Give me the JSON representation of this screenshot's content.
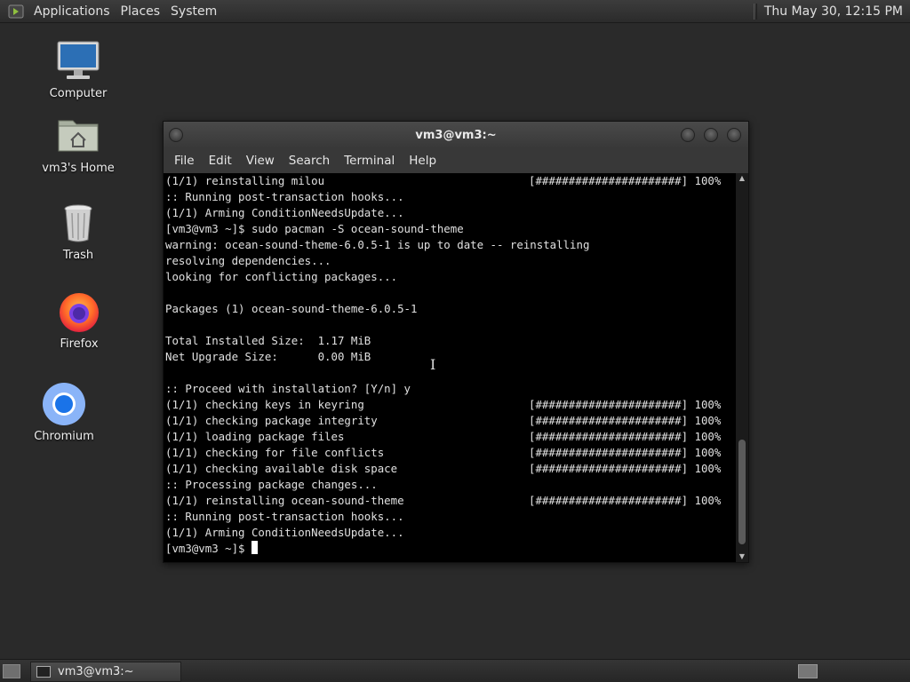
{
  "top_panel": {
    "menus": [
      "Applications",
      "Places",
      "System"
    ],
    "clock": "Thu May 30, 12:15 PM"
  },
  "desktop": {
    "icons": [
      {
        "label": "Computer",
        "icon": "computer-icon"
      },
      {
        "label": "vm3's Home",
        "icon": "home-folder-icon"
      },
      {
        "label": "Trash",
        "icon": "trash-icon"
      },
      {
        "label": "Firefox",
        "icon": "firefox-icon"
      },
      {
        "label": "Chromium",
        "icon": "chromium-icon"
      }
    ]
  },
  "window": {
    "title": "vm3@vm3:~",
    "menu": [
      "File",
      "Edit",
      "View",
      "Search",
      "Terminal",
      "Help"
    ]
  },
  "terminal": {
    "lines": [
      {
        "text": "(1/1) reinstalling milou",
        "progress": "[######################] 100%"
      },
      {
        "text": ":: Running post-transaction hooks...",
        "progress": ""
      },
      {
        "text": "(1/1) Arming ConditionNeedsUpdate...",
        "progress": ""
      },
      {
        "text": "[vm3@vm3 ~]$ sudo pacman -S ocean-sound-theme",
        "progress": ""
      },
      {
        "text": "warning: ocean-sound-theme-6.0.5-1 is up to date -- reinstalling",
        "progress": ""
      },
      {
        "text": "resolving dependencies...",
        "progress": ""
      },
      {
        "text": "looking for conflicting packages...",
        "progress": ""
      },
      {
        "text": "",
        "progress": ""
      },
      {
        "text": "Packages (1) ocean-sound-theme-6.0.5-1",
        "progress": ""
      },
      {
        "text": "",
        "progress": ""
      },
      {
        "text": "Total Installed Size:  1.17 MiB",
        "progress": ""
      },
      {
        "text": "Net Upgrade Size:      0.00 MiB",
        "progress": ""
      },
      {
        "text": "",
        "progress": ""
      },
      {
        "text": ":: Proceed with installation? [Y/n] y",
        "progress": ""
      },
      {
        "text": "(1/1) checking keys in keyring",
        "progress": "[######################] 100%"
      },
      {
        "text": "(1/1) checking package integrity",
        "progress": "[######################] 100%"
      },
      {
        "text": "(1/1) loading package files",
        "progress": "[######################] 100%"
      },
      {
        "text": "(1/1) checking for file conflicts",
        "progress": "[######################] 100%"
      },
      {
        "text": "(1/1) checking available disk space",
        "progress": "[######################] 100%"
      },
      {
        "text": ":: Processing package changes...",
        "progress": ""
      },
      {
        "text": "(1/1) reinstalling ocean-sound-theme",
        "progress": "[######################] 100%"
      },
      {
        "text": ":: Running post-transaction hooks...",
        "progress": ""
      },
      {
        "text": "(1/1) Arming ConditionNeedsUpdate...",
        "progress": ""
      }
    ],
    "prompt": "[vm3@vm3 ~]$ "
  },
  "bottom_panel": {
    "task_label": "vm3@vm3:~"
  }
}
